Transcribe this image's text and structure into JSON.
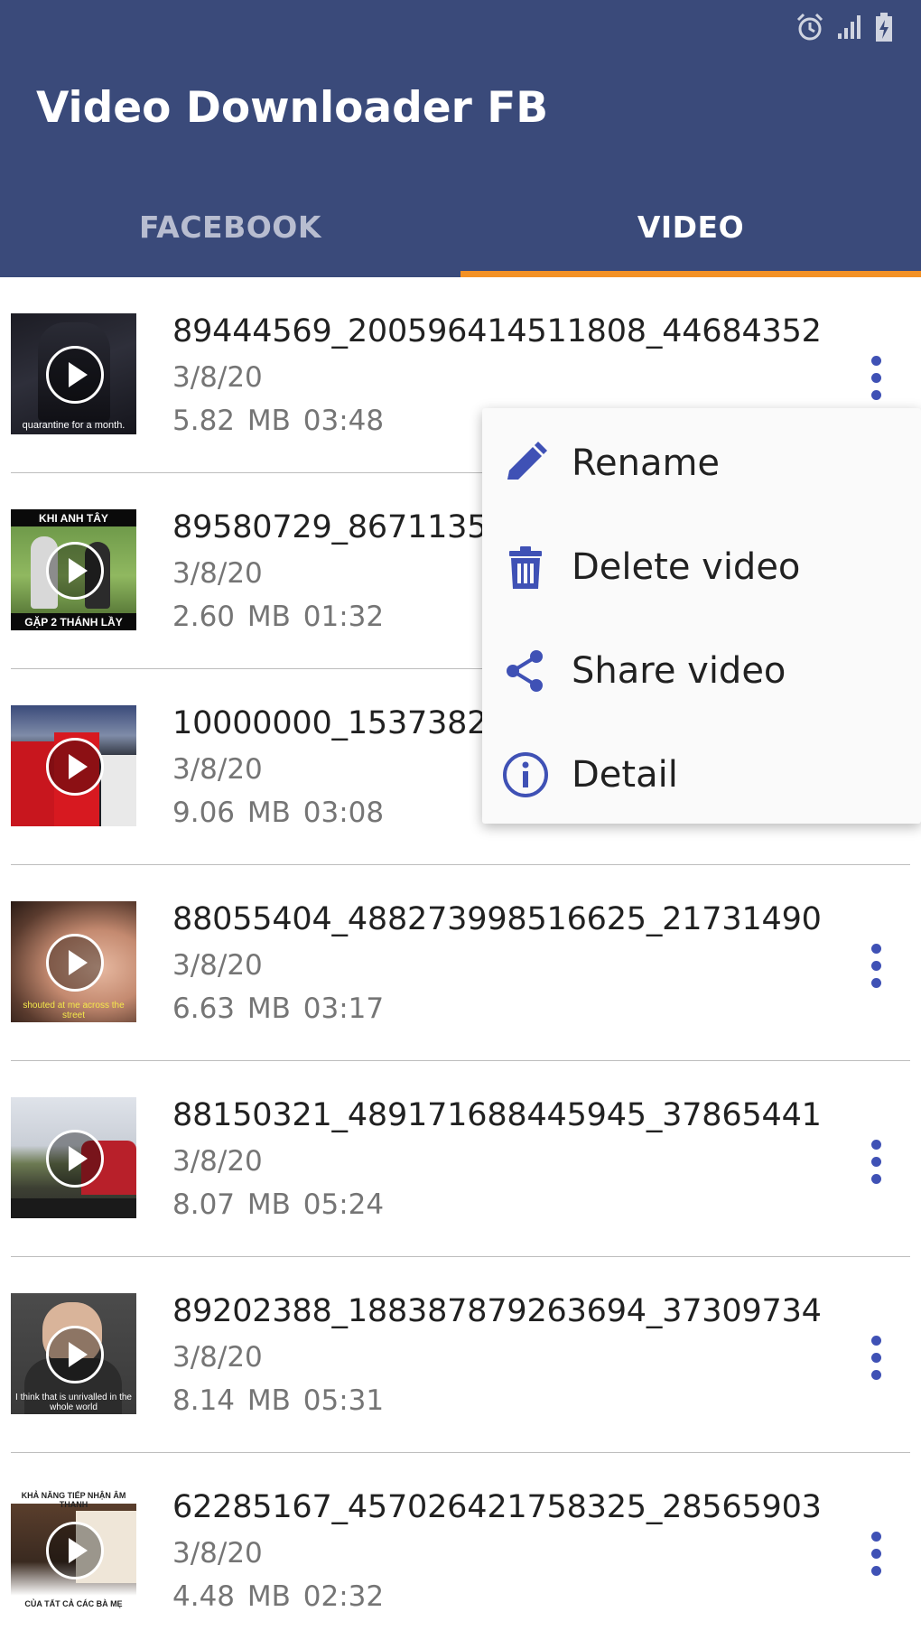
{
  "app": {
    "title": "Video Downloader FB"
  },
  "tabs": [
    {
      "label": "FACEBOOK",
      "active": false
    },
    {
      "label": "VIDEO",
      "active": true
    }
  ],
  "colors": {
    "appbar": "#3a4a7a",
    "tab_indicator": "#f39125",
    "accent_icon": "#3f51b5"
  },
  "videos": [
    {
      "name": "89444569_200596414511808_44684352...",
      "date": "3/8/20",
      "size": "5.82 MB",
      "duration": "03:48"
    },
    {
      "name": "89580729_86711356",
      "date": "3/8/20",
      "size": "2.60 MB",
      "duration": "01:32"
    },
    {
      "name": "10000000_15373820",
      "date": "3/8/20",
      "size": "9.06 MB",
      "duration": "03:08"
    },
    {
      "name": "88055404_488273998516625_21731490...",
      "date": "3/8/20",
      "size": "6.63 MB",
      "duration": "03:17"
    },
    {
      "name": "88150321_489171688445945_37865441...",
      "date": "3/8/20",
      "size": "8.07 MB",
      "duration": "05:24"
    },
    {
      "name": "89202388_188387879263694_37309734...",
      "date": "3/8/20",
      "size": "8.14 MB",
      "duration": "05:31"
    },
    {
      "name": "62285167_457026421758325_28565903...",
      "date": "3/8/20",
      "size": "4.48 MB",
      "duration": "02:32"
    }
  ],
  "thumbnail_texts": {
    "v1": "quarantine for a month.",
    "v2_top": "KHI ANH TÂY",
    "v2_bottom": "GẶP 2 THÁNH LẦY",
    "v4": "shouted at me across the street",
    "v6": "I think that is unrivalled in the whole world",
    "v7_top": "KHẢ NĂNG TIẾP NHẬN ÂM THANH",
    "v7_bottom": "CỦA TẤT CẢ CÁC BÀ MẸ"
  },
  "context_menu": {
    "items": [
      {
        "label": "Rename",
        "icon": "pencil-icon"
      },
      {
        "label": "Delete video",
        "icon": "trash-icon"
      },
      {
        "label": "Share video",
        "icon": "share-icon"
      },
      {
        "label": "Detail",
        "icon": "info-icon"
      }
    ]
  }
}
